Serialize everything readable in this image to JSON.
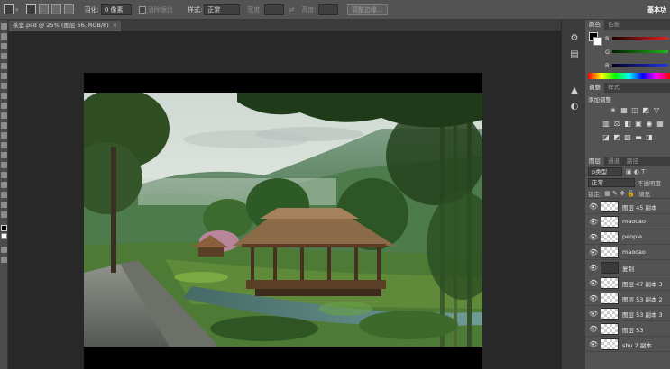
{
  "options_bar": {
    "feather_label": "羽化:",
    "feather_value": "0 像素",
    "antialias_label": "消除锯齿",
    "style_label": "样式:",
    "style_value": "正常",
    "width_label": "宽度:",
    "height_label": "高度:",
    "refine_edge_label": "调整边缘...",
    "right_label": "基本功"
  },
  "document_tab": {
    "title": "茶室.psd @ 25% (图层 56, RGB/8)",
    "close_glyph": "×"
  },
  "color_panel": {
    "tabs": [
      "颜色",
      "色板"
    ],
    "channels": [
      "R",
      "G",
      "B"
    ],
    "accent_colors": {
      "red": "#e0231e",
      "green": "#22b51c",
      "blue": "#1f38e0"
    }
  },
  "adjustments_panel": {
    "tabs": [
      "调整",
      "样式"
    ],
    "title": "添加调整",
    "row1_icons": [
      "☀",
      "▦",
      "◫",
      "◩",
      "▽"
    ],
    "row2_icons": [
      "▥",
      "⚖",
      "◧",
      "▣",
      "◉",
      "▦"
    ],
    "row3_icons": [
      "◪",
      "◩",
      "▧",
      "▬",
      "◨"
    ]
  },
  "layers_panel": {
    "tabs": [
      "图层",
      "通道",
      "路径"
    ],
    "filter_value": "ρ类型",
    "blend_mode": "正常",
    "opacity_label": "不透明度",
    "lock_label": "锁定:",
    "fill_label": "填充",
    "layers": [
      {
        "name": "图层 45 副本",
        "type": "layer"
      },
      {
        "name": "maocao",
        "type": "layer"
      },
      {
        "name": "people",
        "type": "layer"
      },
      {
        "name": "maocao",
        "type": "layer"
      },
      {
        "name": "复制",
        "type": "group"
      },
      {
        "name": "图层 47 副本 3",
        "type": "layer"
      },
      {
        "name": "图层 53 副本 2",
        "type": "layer"
      },
      {
        "name": "图层 53 副本 3",
        "type": "layer"
      },
      {
        "name": "图层 53",
        "type": "layer"
      },
      {
        "name": "shu 2 副本",
        "type": "layer"
      }
    ]
  },
  "icons": {
    "eye": "👁",
    "dock": [
      "⚙",
      "▤",
      "▲",
      "◐"
    ]
  }
}
